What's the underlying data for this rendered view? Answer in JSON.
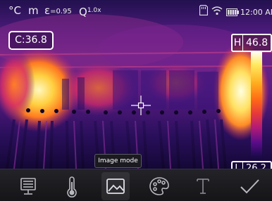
{
  "status_bar": {
    "unit": "°C",
    "distance_unit": "m",
    "emissivity_symbol": "ε",
    "emissivity_value": "=0.95",
    "zoom_symbol": "Q",
    "zoom_value": "1.0x",
    "time": "12:00 AM"
  },
  "measurements": {
    "center": "C:36.8",
    "high_label": "H",
    "high_value": "46.8",
    "low_label": "L",
    "low_value": "26.2"
  },
  "tooltip": "Image mode",
  "toolbar": {
    "buttons": [
      {
        "name": "display-settings",
        "icon": "monitor-icon",
        "active": false
      },
      {
        "name": "measurement",
        "icon": "thermometer-icon",
        "active": false
      },
      {
        "name": "image-mode",
        "icon": "image-icon",
        "active": true
      },
      {
        "name": "palette",
        "icon": "palette-icon",
        "active": false
      },
      {
        "name": "text",
        "icon": "text-icon",
        "active": false
      },
      {
        "name": "confirm",
        "icon": "checkmark-icon",
        "active": false
      }
    ]
  },
  "colors": {
    "hot": "#fff6b0",
    "warm": "#ff8a2a",
    "mid": "#c81e6e",
    "cool": "#3c1478",
    "cold": "#160a3a"
  }
}
